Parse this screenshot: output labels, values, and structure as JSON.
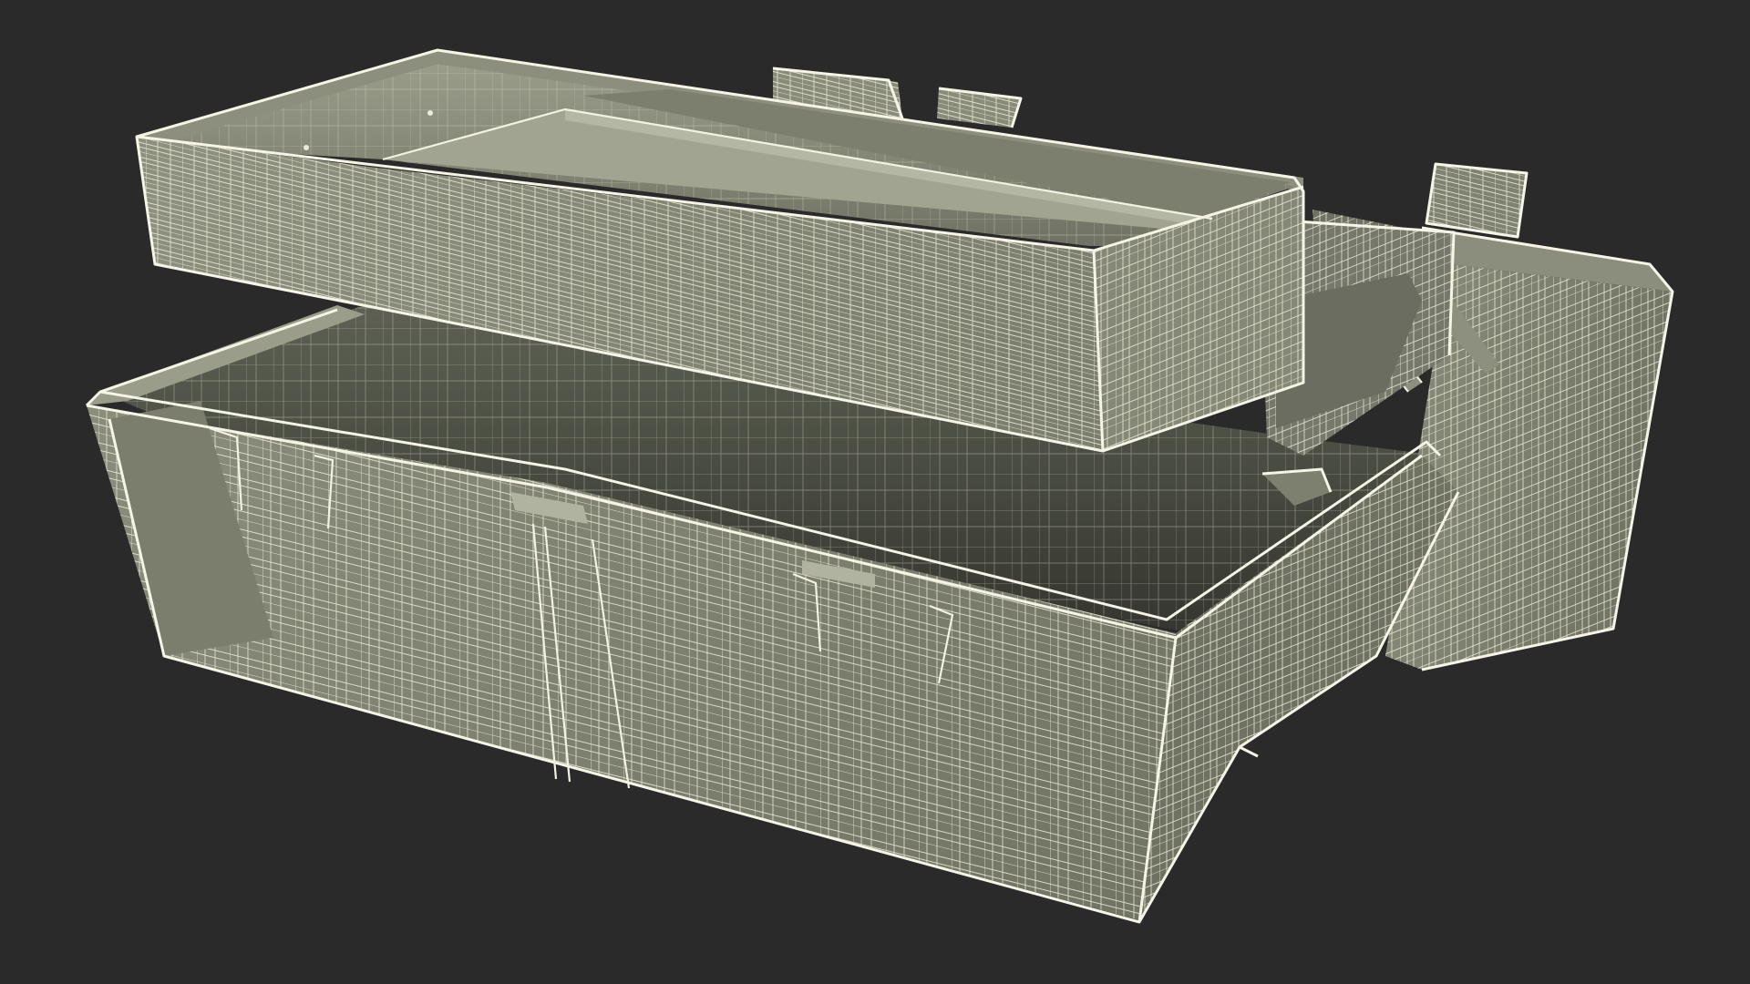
{
  "scene": {
    "subject": "wireframe-tackle-box",
    "render_style": "wireframe-over-shaded",
    "colors": {
      "background": "#2a2a2a",
      "surface_light": "#8f9280",
      "surface_mid": "#7d806f",
      "surface_dark": "#5f6254",
      "interior_dark": "#3d3f36",
      "wire": "#ecebd9"
    }
  }
}
